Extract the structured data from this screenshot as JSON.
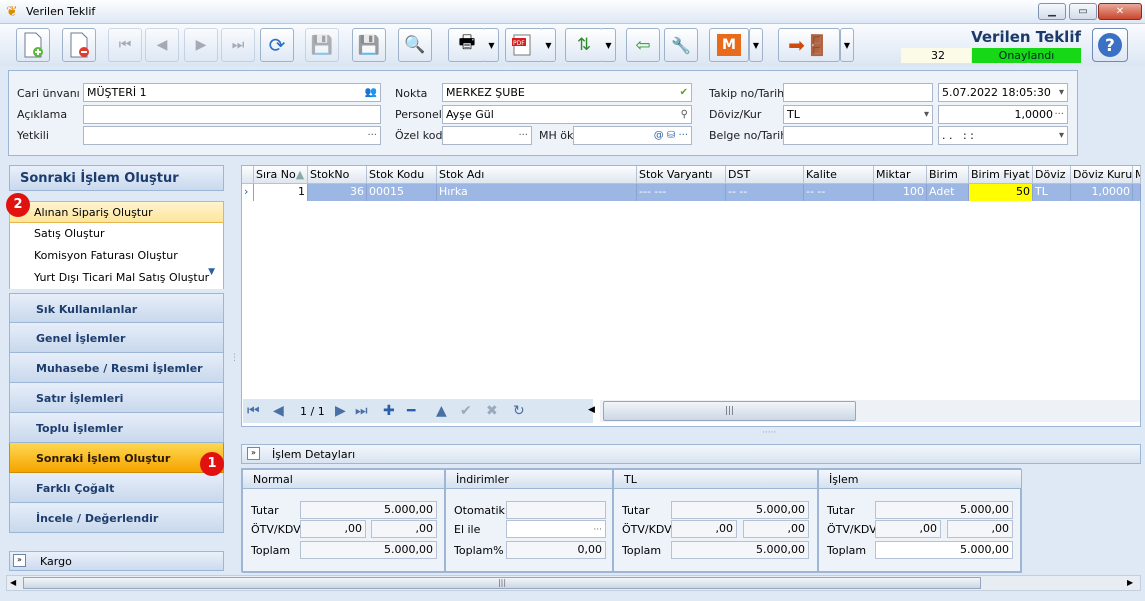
{
  "window": {
    "title": "Verilen Teklif"
  },
  "header_info": {
    "form_title": "Verilen Teklif",
    "doc_no": "32",
    "status": "Onaylandı"
  },
  "toolbar": {
    "m_label": "M"
  },
  "form": {
    "cari_label": "Cari ünvanı",
    "cari_value": "MÜŞTERİ 1",
    "aciklama_label": "Açıklama",
    "aciklama_value": "",
    "yetkili_label": "Yetkili",
    "yetkili_value": "",
    "nokta_label": "Nokta",
    "nokta_value": "MERKEZ ŞUBE",
    "personel_label": "Personel",
    "personel_value": "Ayşe Gül",
    "ozelkod_label": "Özel kod",
    "ozelkod_value": "",
    "mhok_label": "MH ök",
    "mhok_value": "",
    "takip_label": "Takip no/Tarih",
    "takip_value": "",
    "takip_date": "5.07.2022 18:05:30",
    "doviz_label": "Döviz/Kur",
    "doviz_value": "TL",
    "kur_value": "1,0000",
    "belge_label": "Belge no/Tarih",
    "belge_value": "",
    "belge_date": ". .   : :"
  },
  "left_panel": {
    "header": "Sonraki İşlem Oluştur",
    "items": [
      "Alınan Sipariş Oluştur",
      "Satış Oluştur",
      "Komisyon Faturası Oluştur",
      "Yurt Dışı Ticari Mal Satış Oluştur"
    ],
    "groups": [
      "Sık Kullanılanlar",
      "Genel İşlemler",
      "Muhasebe / Resmi İşlemler",
      "Satır İşlemleri",
      "Toplu İşlemler",
      "Sonraki İşlem Oluştur",
      "Farklı Çoğalt",
      "İncele / Değerlendir"
    ],
    "kargo": "Kargo",
    "badge1": "1",
    "badge2": "2"
  },
  "grid": {
    "columns": [
      "Sıra No",
      "StokNo",
      "Stok Kodu",
      "Stok Adı",
      "Stok Varyantı",
      "DST",
      "Kalite",
      "Miktar",
      "Birim",
      "Birim Fiyat",
      "Döviz",
      "Döviz Kuru",
      "M"
    ],
    "row": {
      "sira": "1",
      "stokno": "36",
      "kodu": "00015",
      "adi": "Hırka",
      "varyant": "--- ---",
      "dst": "-- --",
      "kalite": "-- --",
      "miktar": "100",
      "birim": "Adet",
      "fiyat": "50",
      "doviz": "TL",
      "kur": "1,0000"
    },
    "pager": "1 / 1"
  },
  "details": {
    "bar_label": "İşlem Detayları",
    "normal": {
      "title": "Normal",
      "tutar_label": "Tutar",
      "tutar": "5.000,00",
      "otv_label": "ÖTV/KDV",
      "otv": ",00",
      "kdv": ",00",
      "toplam_label": "Toplam",
      "toplam": "5.000,00"
    },
    "indirim": {
      "title": "İndirimler",
      "otomatik_label": "Otomatik",
      "otomatik": "",
      "elile_label": "El ile",
      "elile": "",
      "toplam_label": "Toplam%",
      "toplam": "0,00"
    },
    "tl": {
      "title": "TL",
      "tutar_label": "Tutar",
      "tutar": "5.000,00",
      "otv_label": "ÖTV/KDV",
      "otv": ",00",
      "kdv": ",00",
      "toplam_label": "Toplam",
      "toplam": "5.000,00"
    },
    "islem": {
      "title": "İşlem",
      "tutar_label": "Tutar",
      "tutar": "5.000,00",
      "otv_label": "ÖTV/KDV",
      "otv": ",00",
      "kdv": ",00",
      "toplam_label": "Toplam",
      "toplam": "5.000,00"
    }
  }
}
